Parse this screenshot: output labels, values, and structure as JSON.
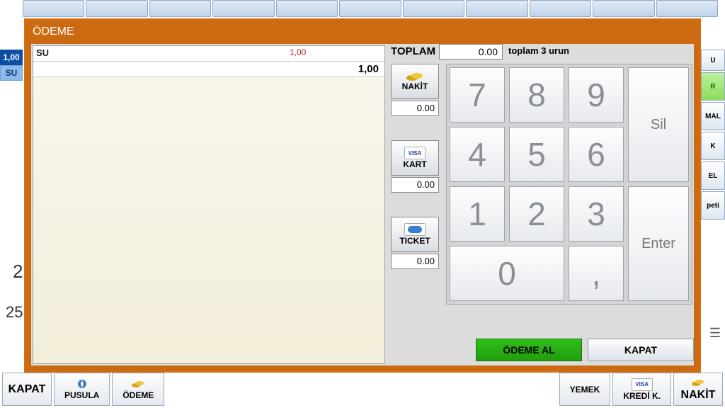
{
  "bg": {
    "left_qty": "1,00",
    "left_item": "SU",
    "num_2": "2",
    "num_25": "25",
    "right": {
      "r": "R",
      "mal": "MAL",
      "k": "K",
      "el": "EL",
      "peti": "peti"
    },
    "bottom": {
      "kapat": "KAPAT",
      "pusula": "PUSULA",
      "odeme": "ÖDEME",
      "yemek": "YEMEK",
      "kredi": "KREDİ K.",
      "nakit": "NAKİT"
    }
  },
  "modal": {
    "title": "ÖDEME",
    "item": {
      "name": "SU",
      "qty": "1,00",
      "price": "1,00"
    },
    "total_label": "TOPLAM",
    "total_value": "0.00",
    "summary": "toplam 3 urun",
    "pay": {
      "nakit": {
        "label": "NAKİT",
        "amount": "0.00"
      },
      "kart": {
        "label": "KART",
        "amount": "0.00"
      },
      "ticket": {
        "label": "TICKET",
        "amount": "0.00"
      }
    },
    "keys": {
      "k7": "7",
      "k8": "8",
      "k9": "9",
      "k4": "4",
      "k5": "5",
      "k6": "6",
      "k1": "1",
      "k2": "2",
      "k3": "3",
      "k0": "0",
      "comma": ",",
      "sil": "Sil",
      "enter": "Enter"
    },
    "accept": "ÖDEME AL",
    "close": "KAPAT"
  }
}
